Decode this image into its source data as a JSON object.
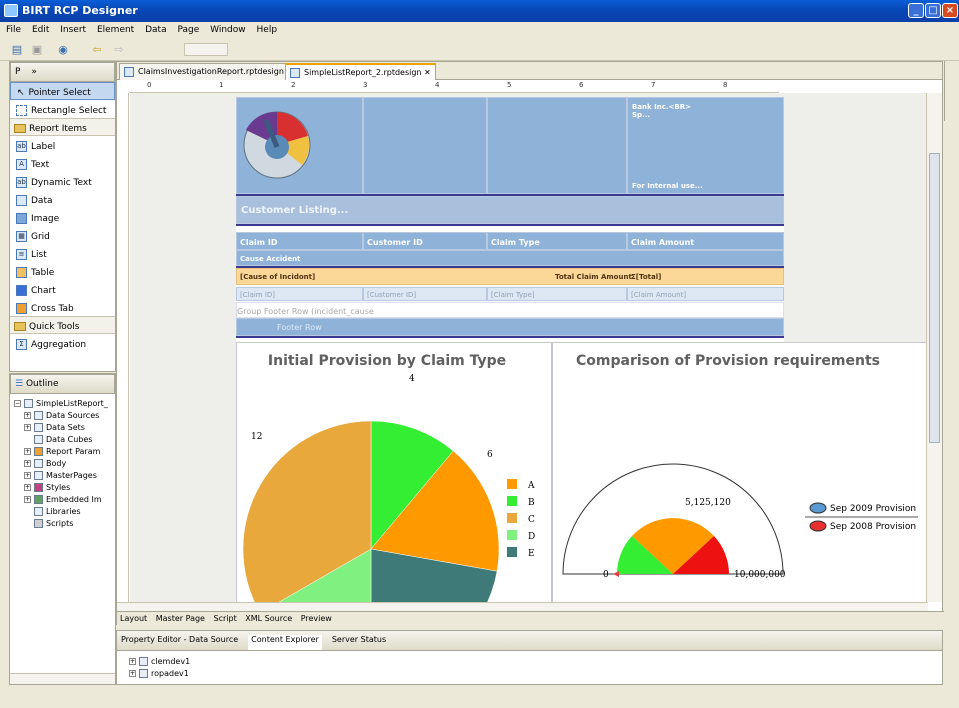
{
  "window": {
    "title": "BIRT RCP Designer"
  },
  "menu": [
    "File",
    "Edit",
    "Insert",
    "Element",
    "Data",
    "Page",
    "Window",
    "Help"
  ],
  "palette": {
    "tab_label": "P",
    "pointer": "Pointer Select",
    "rectangle": "Rectangle Select",
    "report_items_header": "Report Items",
    "report_items": [
      "Label",
      "Text",
      "Dynamic Text",
      "Data",
      "Image",
      "Grid",
      "List",
      "Table",
      "Chart",
      "Cross Tab"
    ],
    "quick_tools_header": "Quick Tools",
    "quick_tools": [
      "Aggregation"
    ]
  },
  "outline": {
    "title": "Outline",
    "root": "SimpleListReport_",
    "items": [
      "Data Sources",
      "Data Sets",
      "Data Cubes",
      "Report Param",
      "Body",
      "MasterPages",
      "Styles",
      "Embedded Im",
      "Libraries",
      "Scripts"
    ]
  },
  "editor": {
    "tabs": [
      "ClaimsInvestigationReport.rptdesign",
      "SimpleListReport_2.rptdesign"
    ],
    "bottom_tabs": [
      "Layout",
      "Master Page",
      "Script",
      "XML Source",
      "Preview"
    ],
    "ruler_marks": [
      "0",
      "1",
      "2",
      "3",
      "4",
      "5",
      "6",
      "7",
      "8"
    ]
  },
  "report": {
    "bank_text": "Bank Inc.<BR>",
    "bank_sub": "Sp...",
    "internal": "For Internal use...",
    "customer_listing": "Customer Listing...",
    "columns": [
      "Claim ID",
      "Customer ID",
      "Claim Type",
      "Claim Amount"
    ],
    "cause_accident": "Cause Accident",
    "cause_of_incident": "[Cause of Incidont]",
    "total_claim_label": "Total Claim Amount",
    "total_value": "Σ[Total]",
    "detail": [
      "[Claim ID]",
      "[Customer ID]",
      "[Claim Type]",
      "[Claim Amount]"
    ],
    "group_footer": "Group Footer Row (incident_cause",
    "footer_row": "Footer Row"
  },
  "chart_data": [
    {
      "type": "pie",
      "title": "Initial Provision by Claim Type",
      "categories": [
        "A",
        "B",
        "C",
        "D",
        "E"
      ],
      "values": [
        6,
        4,
        12,
        6,
        8
      ],
      "data_labels": [
        "4",
        "6",
        "12"
      ],
      "colors": [
        "#ff9900",
        "#33ee33",
        "#e8a83c",
        "#80f080",
        "#3e7a78"
      ],
      "legend": "right"
    },
    {
      "type": "gauge",
      "title": "Comparison of Provision requirements",
      "min_label": "0",
      "max_label": "10,000,000",
      "value_label": "5,125,120",
      "series": [
        {
          "name": "Sep 2009 Provision",
          "color": "#5a9ad0"
        },
        {
          "name": "Sep 2008 Provision",
          "color": "#e83030"
        }
      ],
      "legend": "right"
    }
  ],
  "bottom": {
    "tabs": [
      "Property Editor - Data Source",
      "Content Explorer",
      "Server Status"
    ],
    "items": [
      "clemdev1",
      "ropadev1"
    ]
  }
}
